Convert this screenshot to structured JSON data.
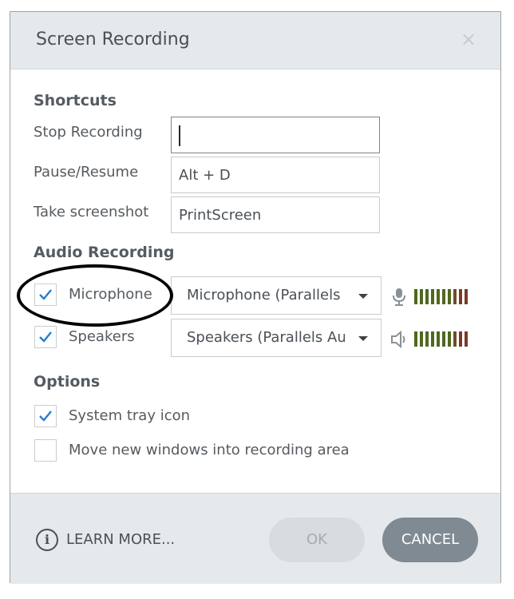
{
  "dialog": {
    "title": "Screen Recording",
    "close_glyph": "×"
  },
  "shortcuts": {
    "heading": "Shortcuts",
    "items": [
      {
        "label": "Stop Recording",
        "value": ""
      },
      {
        "label": "Pause/Resume",
        "value": "Alt + D"
      },
      {
        "label": "Take screenshot",
        "value": "PrintScreen"
      }
    ]
  },
  "audio": {
    "heading": "Audio Recording",
    "microphone": {
      "label": "Microphone",
      "checked": true,
      "selected": "Microphone (Parallels Audio Controller)",
      "icon": "microphone-icon"
    },
    "speakers": {
      "label": "Speakers",
      "checked": true,
      "selected": "Speakers (Parallels Audio Controller)",
      "icon": "speaker-icon"
    }
  },
  "options": {
    "heading": "Options",
    "system_tray": {
      "label": "System tray icon",
      "checked": true
    },
    "move_windows": {
      "label": "Move new windows into recording area",
      "checked": false
    }
  },
  "footer": {
    "learn_more": "LEARN MORE...",
    "info_glyph": "i",
    "ok": "OK",
    "cancel": "CANCEL"
  },
  "colors": {
    "accent": "#2b7bd0",
    "meter_green": "#50681f",
    "meter_red": "#7a3a2a",
    "cancel_bg": "#7f8a93"
  }
}
